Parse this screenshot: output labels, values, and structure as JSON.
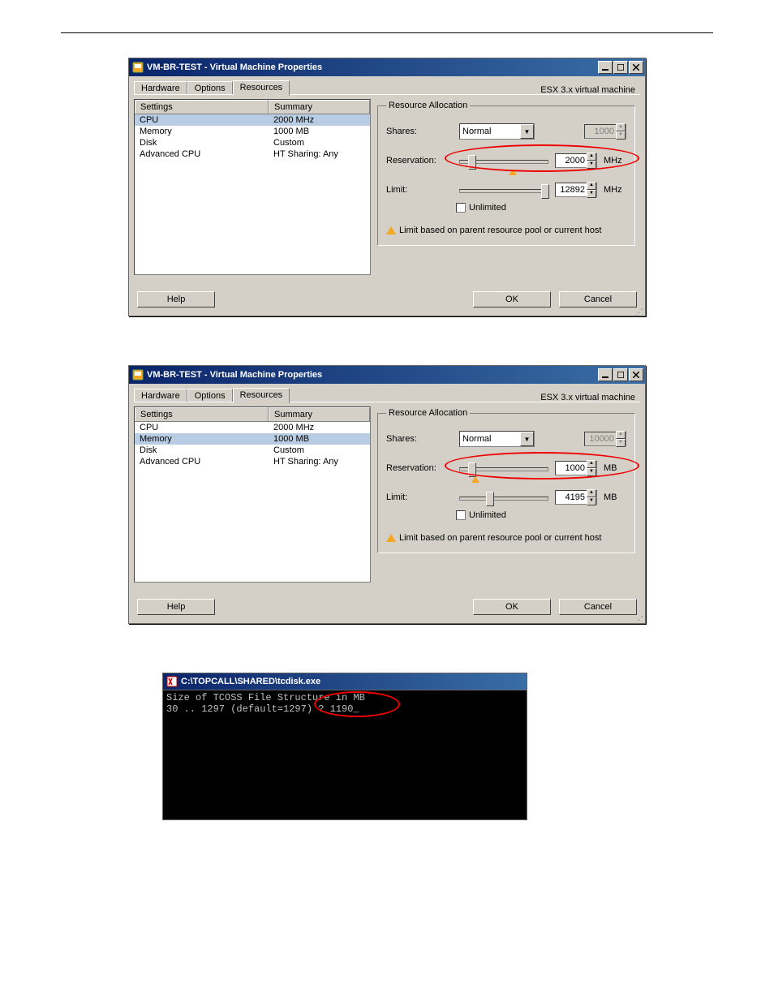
{
  "dialogs": [
    {
      "title": "VM-BR-TEST - Virtual Machine Properties",
      "esx_label": "ESX 3.x virtual machine",
      "tabs": [
        "Hardware",
        "Options",
        "Resources"
      ],
      "active_tab": 2,
      "columns": {
        "c1": "Settings",
        "c2": "Summary"
      },
      "rows": [
        {
          "setting": "CPU",
          "summary": "2000 MHz",
          "selected": true
        },
        {
          "setting": "Memory",
          "summary": "1000 MB"
        },
        {
          "setting": "Disk",
          "summary": "Custom"
        },
        {
          "setting": "Advanced CPU",
          "summary": "HT Sharing: Any"
        }
      ],
      "ra": {
        "legend": "Resource Allocation",
        "shares_label": "Shares:",
        "shares_value": "Normal",
        "shares_num": "1000",
        "reservation_label": "Reservation:",
        "reservation_value": "2000",
        "reservation_unit": "MHz",
        "reservation_thumb_pct": 10,
        "reservation_tri_pct": 55,
        "limit_label": "Limit:",
        "limit_value": "12892",
        "limit_unit": "MHz",
        "limit_thumb_pct": 92,
        "unlimited_label": "Unlimited",
        "hint": "Limit based on parent resource pool or current host"
      },
      "buttons": {
        "help": "Help",
        "ok": "OK",
        "cancel": "Cancel"
      },
      "highlight": "reservation"
    },
    {
      "title": "VM-BR-TEST - Virtual Machine Properties",
      "esx_label": "ESX 3.x virtual machine",
      "tabs": [
        "Hardware",
        "Options",
        "Resources"
      ],
      "active_tab": 2,
      "columns": {
        "c1": "Settings",
        "c2": "Summary"
      },
      "rows": [
        {
          "setting": "CPU",
          "summary": "2000 MHz"
        },
        {
          "setting": "Memory",
          "summary": "1000 MB",
          "selected": true
        },
        {
          "setting": "Disk",
          "summary": "Custom"
        },
        {
          "setting": "Advanced CPU",
          "summary": "HT Sharing: Any"
        }
      ],
      "ra": {
        "legend": "Resource Allocation",
        "shares_label": "Shares:",
        "shares_value": "Normal",
        "shares_num": "10000",
        "reservation_label": "Reservation:",
        "reservation_value": "1000",
        "reservation_unit": "MB",
        "reservation_thumb_pct": 10,
        "reservation_tri_pct": 14,
        "limit_label": "Limit:",
        "limit_value": "4195",
        "limit_unit": "MB",
        "limit_thumb_pct": 30,
        "unlimited_label": "Unlimited",
        "hint": "Limit based on parent resource pool or current host"
      },
      "buttons": {
        "help": "Help",
        "ok": "OK",
        "cancel": "Cancel"
      },
      "highlight": "reservation"
    }
  ],
  "console": {
    "title": "C:\\TOPCALL\\SHARED\\tcdisk.exe",
    "line1": "Size of TCOSS File Structure in MB",
    "line2": "30 .. 1297 (default=1297) ? 1190_"
  }
}
